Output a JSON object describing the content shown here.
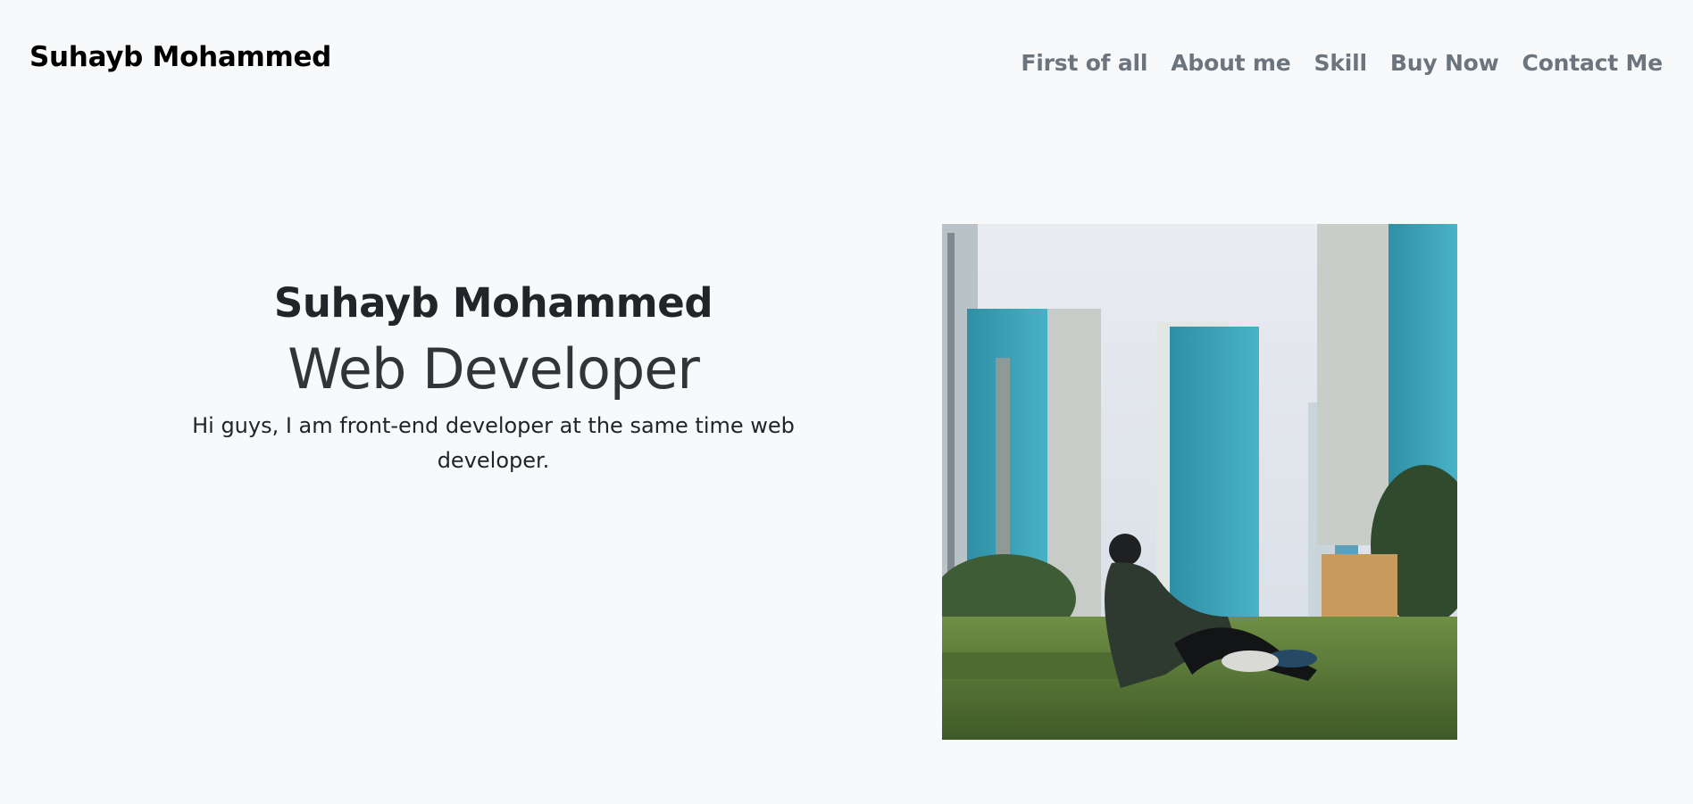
{
  "navbar": {
    "brand": "Suhayb Mohammed",
    "links": [
      {
        "label": "First of all"
      },
      {
        "label": "About me"
      },
      {
        "label": "Skill"
      },
      {
        "label": "Buy Now"
      },
      {
        "label": "Contact Me"
      }
    ]
  },
  "hero": {
    "name": "Suhayb Mohammed",
    "role": "Web Developer",
    "description": "Hi guys, I am front-end developer at the same time web developer."
  },
  "colors": {
    "background": "#f8f9fa",
    "nav_link": "#6c757d",
    "text": "#212529"
  }
}
